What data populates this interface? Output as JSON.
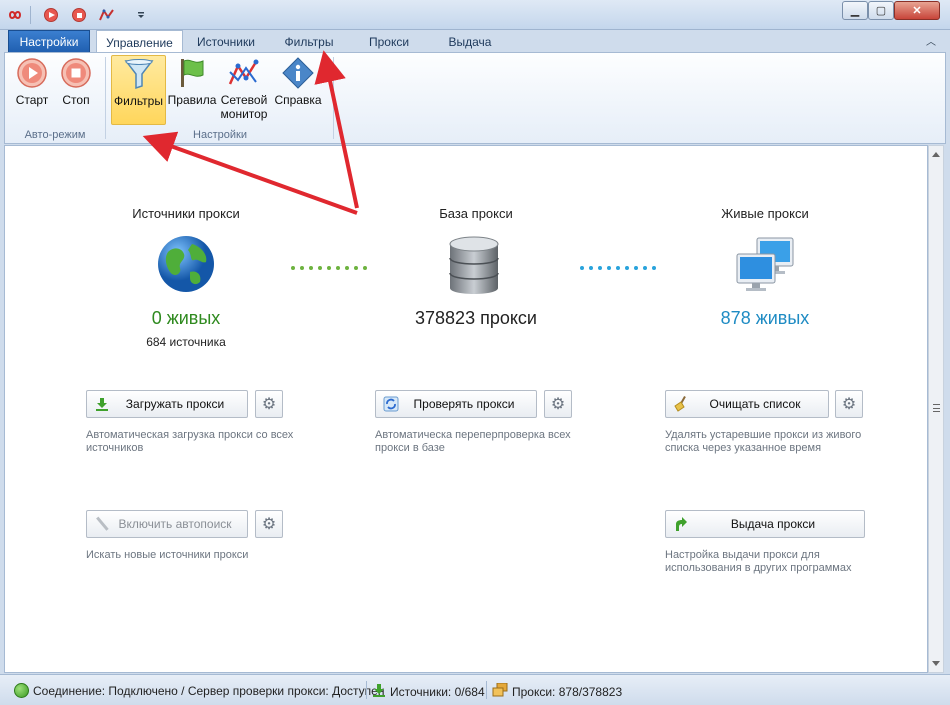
{
  "titlebar": {
    "buttons": [
      "minimize",
      "maximize",
      "close"
    ]
  },
  "tabs": [
    {
      "label": "Настройки",
      "kind": "file"
    },
    {
      "label": "Управление",
      "kind": "active"
    },
    {
      "label": "Источники"
    },
    {
      "label": "Фильтры"
    },
    {
      "label": "Прокси"
    },
    {
      "label": "Выдача"
    }
  ],
  "ribbon": {
    "buttons": {
      "start": "Старт",
      "stop": "Стоп",
      "filters": "Фильтры",
      "rules": "Правила",
      "netmon_line1": "Сетевой",
      "netmon_line2": "монитор",
      "help": "Справка"
    },
    "groups": {
      "auto": "Авто-режим",
      "settings": "Настройки"
    }
  },
  "main": {
    "sources": {
      "title": "Источники прокси",
      "alive": "0 живых",
      "count": "684 источника"
    },
    "base": {
      "title": "База прокси",
      "total": "378823 прокси"
    },
    "live": {
      "title": "Живые прокси",
      "alive": "878 живых"
    },
    "actions": {
      "load": {
        "label": "Загружать прокси",
        "desc": "Автоматическая загрузка прокси со всех источников"
      },
      "check": {
        "label": "Проверять прокси",
        "desc": "Автоматическа переперпроверка всех прокси в базе"
      },
      "clear": {
        "label": "Очищать список",
        "desc": "Удалять устаревшие прокси из живого списка через указанное время"
      },
      "autosearch": {
        "label": "Включить автопоиск",
        "desc": "Искать новые источники прокси"
      },
      "output": {
        "label": "Выдача прокси",
        "desc": "Настройка выдачи прокси для использования в других программах"
      }
    }
  },
  "status": {
    "connection": "Соединение: Подключено / Сервер проверки прокси: Доступен",
    "sources": "Источники: 0/684",
    "proxies": "Прокси: 878/378823"
  },
  "colors": {
    "green": "#2f8a1f",
    "blue": "#1e8bc3",
    "arrow": "#e0282f"
  }
}
